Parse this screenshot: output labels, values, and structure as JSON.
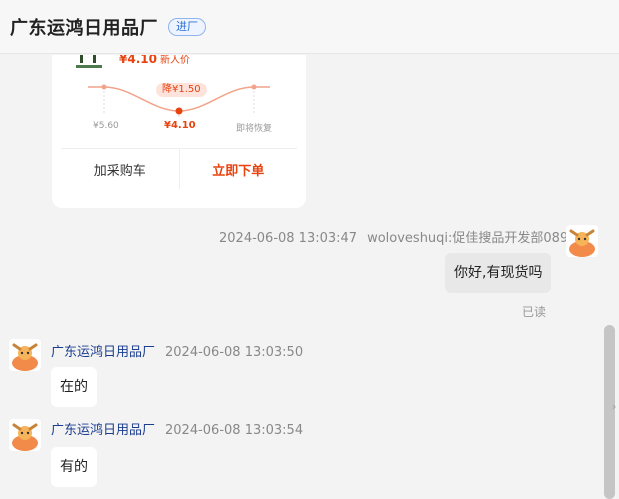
{
  "header": {
    "title": "广东运鸿日用品厂",
    "badge": "进厂"
  },
  "product_card": {
    "price": "¥4.10",
    "price_tag": "新人价",
    "drop_badge": "降¥1.50",
    "price_points": [
      {
        "label": "¥5.60",
        "value": 5.6
      },
      {
        "label": "¥4.10",
        "value": 4.1
      },
      {
        "label": "即将恢复",
        "value": 5.6
      }
    ],
    "add_cart_label": "加采购车",
    "buy_now_label": "立即下单",
    "accent_color": "#e8430f"
  },
  "messages": [
    {
      "side": "right",
      "time": "2024-06-08 13:03:47",
      "sender": "woloveshuqi:促佳搜品开发部089",
      "text": "你好,有现货吗",
      "status": "已读"
    },
    {
      "side": "left",
      "time": "2024-06-08 13:03:50",
      "sender": "广东运鸿日用品厂",
      "text": "在的"
    },
    {
      "side": "left",
      "time": "2024-06-08 13:03:54",
      "sender": "广东运鸿日用品厂",
      "text": "有的"
    }
  ]
}
